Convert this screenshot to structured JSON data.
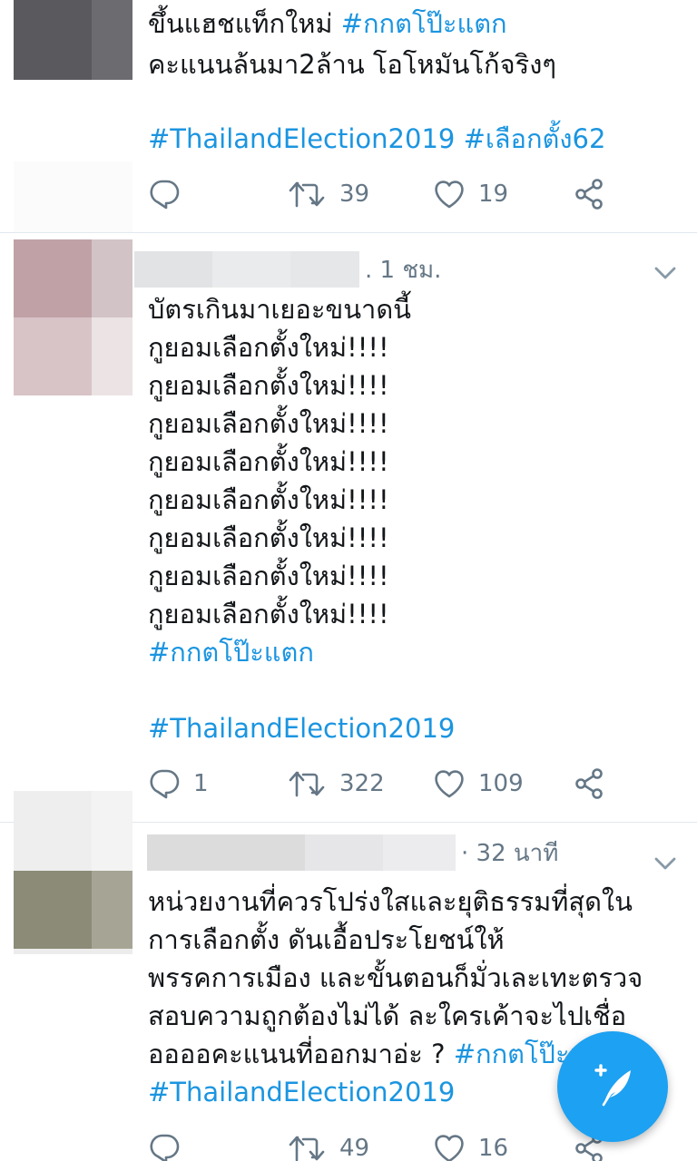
{
  "tweets": [
    {
      "lines": [
        {
          "text": "ขึ้นแฮชแท็กใหม่ ",
          "hashtag": "#กกตโป๊ะแตก"
        },
        {
          "text": "คะแนนล้นมา2ล้าน โอโหมันโก้จริงๆ",
          "hashtag": ""
        },
        {
          "text": "",
          "hashtag": ""
        },
        {
          "text": "",
          "hashtag": "#ThailandElection2019 #เลือกตั้ง62"
        }
      ],
      "replies": "",
      "retweets": "39",
      "likes": "19"
    },
    {
      "time": ". 1 ชม.",
      "lines": [
        {
          "text": "บัตรเกินมาเยอะขนาดนี้",
          "hashtag": ""
        },
        {
          "text": "กูยอมเลือกตั้งใหม่!!!!",
          "hashtag": ""
        },
        {
          "text": "กูยอมเลือกตั้งใหม่!!!!",
          "hashtag": ""
        },
        {
          "text": "กูยอมเลือกตั้งใหม่!!!!",
          "hashtag": ""
        },
        {
          "text": "กูยอมเลือกตั้งใหม่!!!!",
          "hashtag": ""
        },
        {
          "text": "กูยอมเลือกตั้งใหม่!!!!",
          "hashtag": ""
        },
        {
          "text": "กูยอมเลือกตั้งใหม่!!!!",
          "hashtag": ""
        },
        {
          "text": "กูยอมเลือกตั้งใหม่!!!!",
          "hashtag": ""
        },
        {
          "text": "กูยอมเลือกตั้งใหม่!!!!",
          "hashtag": ""
        },
        {
          "text": "",
          "hashtag": "#กกตโป๊ะแตก"
        },
        {
          "text": "",
          "hashtag": ""
        },
        {
          "text": "",
          "hashtag": "#ThailandElection2019"
        }
      ],
      "replies": "1",
      "retweets": "322",
      "likes": "109"
    },
    {
      "time": "· 32 นาที",
      "lines": [
        {
          "text": "หน่วยงานที่ควรโปร่งใสและยุติธรรมที่สุดใน",
          "hashtag": ""
        },
        {
          "text": "การเลือกตั้ง ดันเอื้อประโยชน์ให้",
          "hashtag": ""
        },
        {
          "text": "พรรคการเมือง และขั้นตอนก็มั่วเละเทะตรวจ",
          "hashtag": ""
        },
        {
          "text": "สอบความถูกต้องไม่ได้ ละใครเค้าจะไปเชื่อ",
          "hashtag": ""
        },
        {
          "text": "ออออคะแนนที่ออกมาอ่ะ ? ",
          "hashtag": "#กกตโป๊ะแตก"
        },
        {
          "text": "",
          "hashtag": "#ThailandElection2019"
        }
      ],
      "replies": "",
      "retweets": "49",
      "likes": "16"
    }
  ],
  "icons": {
    "reply": "reply-icon",
    "retweet": "retweet-icon",
    "like": "heart-icon",
    "share": "share-icon",
    "more": "chevron-down-icon",
    "compose": "compose-tweet-icon"
  },
  "colors": {
    "hashtag": "#1b95e0",
    "icon": "#657786",
    "fab": "#1da1f2",
    "divider": "#e1e8ed"
  }
}
